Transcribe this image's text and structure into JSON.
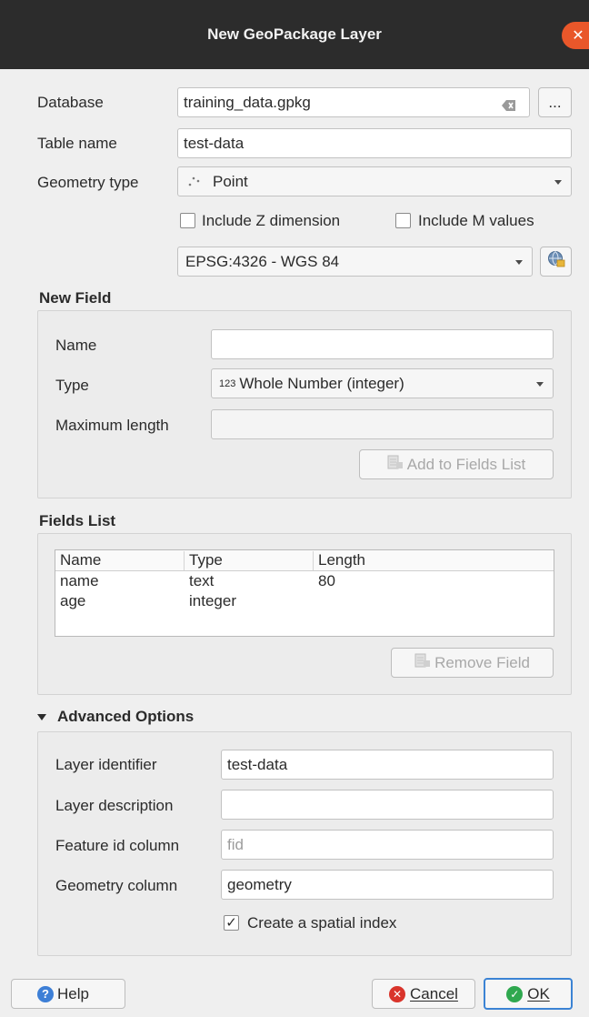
{
  "window": {
    "title": "New GeoPackage Layer",
    "close_symbol": "✕"
  },
  "database": {
    "label": "Database",
    "value": "training_data.gpkg",
    "browse_label": "..."
  },
  "table_name": {
    "label": "Table name",
    "value": "test-data"
  },
  "geometry": {
    "label": "Geometry type",
    "value": "Point"
  },
  "options": {
    "include_z": "Include Z dimension",
    "include_m": "Include M values"
  },
  "crs": {
    "value": "EPSG:4326 - WGS 84"
  },
  "new_field": {
    "section_title": "New Field",
    "name_label": "Name",
    "name_value": "",
    "type_label": "Type",
    "type_prefix": "123",
    "type_value": "Whole Number (integer)",
    "maxlen_label": "Maximum length",
    "maxlen_value": "",
    "add_button": "Add to Fields List"
  },
  "fields_list": {
    "section_title": "Fields List",
    "columns": [
      "Name",
      "Type",
      "Length"
    ],
    "rows": [
      {
        "name": "name",
        "type": "text",
        "length": "80"
      },
      {
        "name": "age",
        "type": "integer",
        "length": ""
      }
    ],
    "remove_button": "Remove Field"
  },
  "advanced": {
    "section_title": "Advanced Options",
    "layer_id_label": "Layer identifier",
    "layer_id_value": "test-data",
    "layer_desc_label": "Layer description",
    "layer_desc_value": "",
    "fid_label": "Feature id column",
    "fid_placeholder": "fid",
    "geom_col_label": "Geometry column",
    "geom_col_value": "geometry",
    "spatial_index_label": "Create a spatial index",
    "spatial_index_checked": true
  },
  "buttons": {
    "help": "Help",
    "cancel": "Cancel",
    "ok": "OK"
  },
  "colors": {
    "titlebar": "#2c2c2c",
    "close": "#e9572a",
    "help": "#3d7fd6",
    "cancel": "#d9342b",
    "ok": "#2fa84f",
    "ok_border": "#3b83d4"
  }
}
